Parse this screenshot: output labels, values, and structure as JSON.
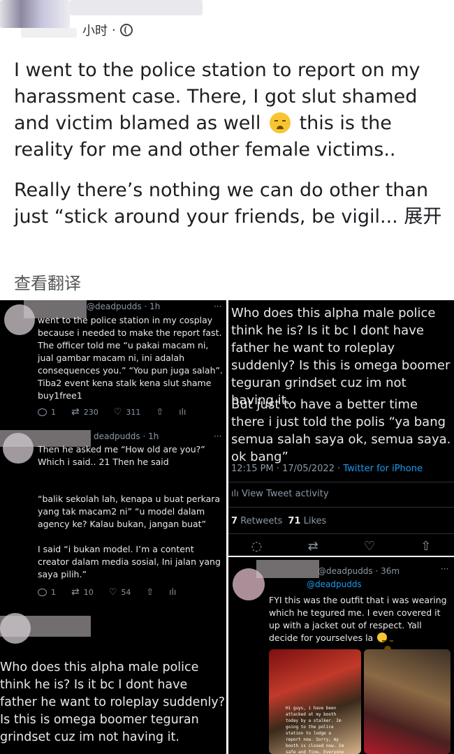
{
  "header": {
    "time": "小时",
    "dot": "·"
  },
  "post": {
    "para1_a": "I went to the police station to report on my harassment case. There, I got slut shamed and victim blamed as well",
    "para1_emoji": "sleepy-face-emoji",
    "para1_b": "this is the reality for me and other female victims..",
    "para2": "Really there’s nothing we can do other than just “stick around your friends, be vigil...",
    "expand_label": "展开",
    "translate_label": "查看翻译"
  },
  "left_panel": {
    "tweet1": {
      "handle": "@deadpudds · 1h",
      "text": "went to the police station in my cosplay because i needed to make the report fast. The officer told me “u pakai macam ni, jual gambar macam ni, ini adalah consequences you.” “You pun juga salah”. Tiba2 event kena stalk kena slut shame buy1free1",
      "replies": "1",
      "retweets": "230",
      "likes": "311"
    },
    "tweet2": {
      "handle": "deadpudds · 1h",
      "text1": "Then he asked me “How old are you?” Which i said.. 21 Then he said",
      "text2": "“balik sekolah lah, kenapa u buat perkara yang tak macam2 ni” “u model dalam agency ke? Kalau bukan, jangan buat”",
      "text3": "I said “i bukan model. I’m a content creator dalam media sosial, Ini jalan yang saya pilih.”",
      "replies": "1",
      "retweets": "10",
      "likes": "54"
    },
    "tweet3": {
      "text": "Who does this alpha male police think he is? Is it bc I dont have father he want to roleplay suddenly? Is this is omega boomer teguran grindset cuz im not having it."
    }
  },
  "right_top_panel": {
    "text1": "Who does this alpha male police think he is? Is it bc I dont have father he want to roleplay suddenly? Is this is omega boomer teguran grindset cuz im not having it.",
    "text2": "But just to have a better time there i just told the polis “ya bang semua salah saya ok, semua saya. ok bang”",
    "timestamp": "12:15 PM · 17/05/2022 · ",
    "source": "Twitter for iPhone",
    "activity": "View Tweet activity",
    "retweets_count": "7",
    "retweets_label": "Retweets",
    "likes_count": "71",
    "likes_label": "Likes"
  },
  "right_bottom_panel": {
    "handle": "@deadpudds · 36m",
    "replying": "@deadpudds",
    "text": "FYI this was the outfit that i was wearing which he tegured me. I even covered it up with a jacket out of respect. Yall decide for yourselves la",
    "story_text": "Hi guys, i have been attacked at my booth today by a stalker. Im going to the police station to lodge a report now. Sorry, my booth is closed now. Im safe and fine. Everyone"
  },
  "colors": {
    "twitter_blue": "#1d9bf0",
    "twitter_bg": "#000000",
    "muted": "#8b98a5"
  }
}
